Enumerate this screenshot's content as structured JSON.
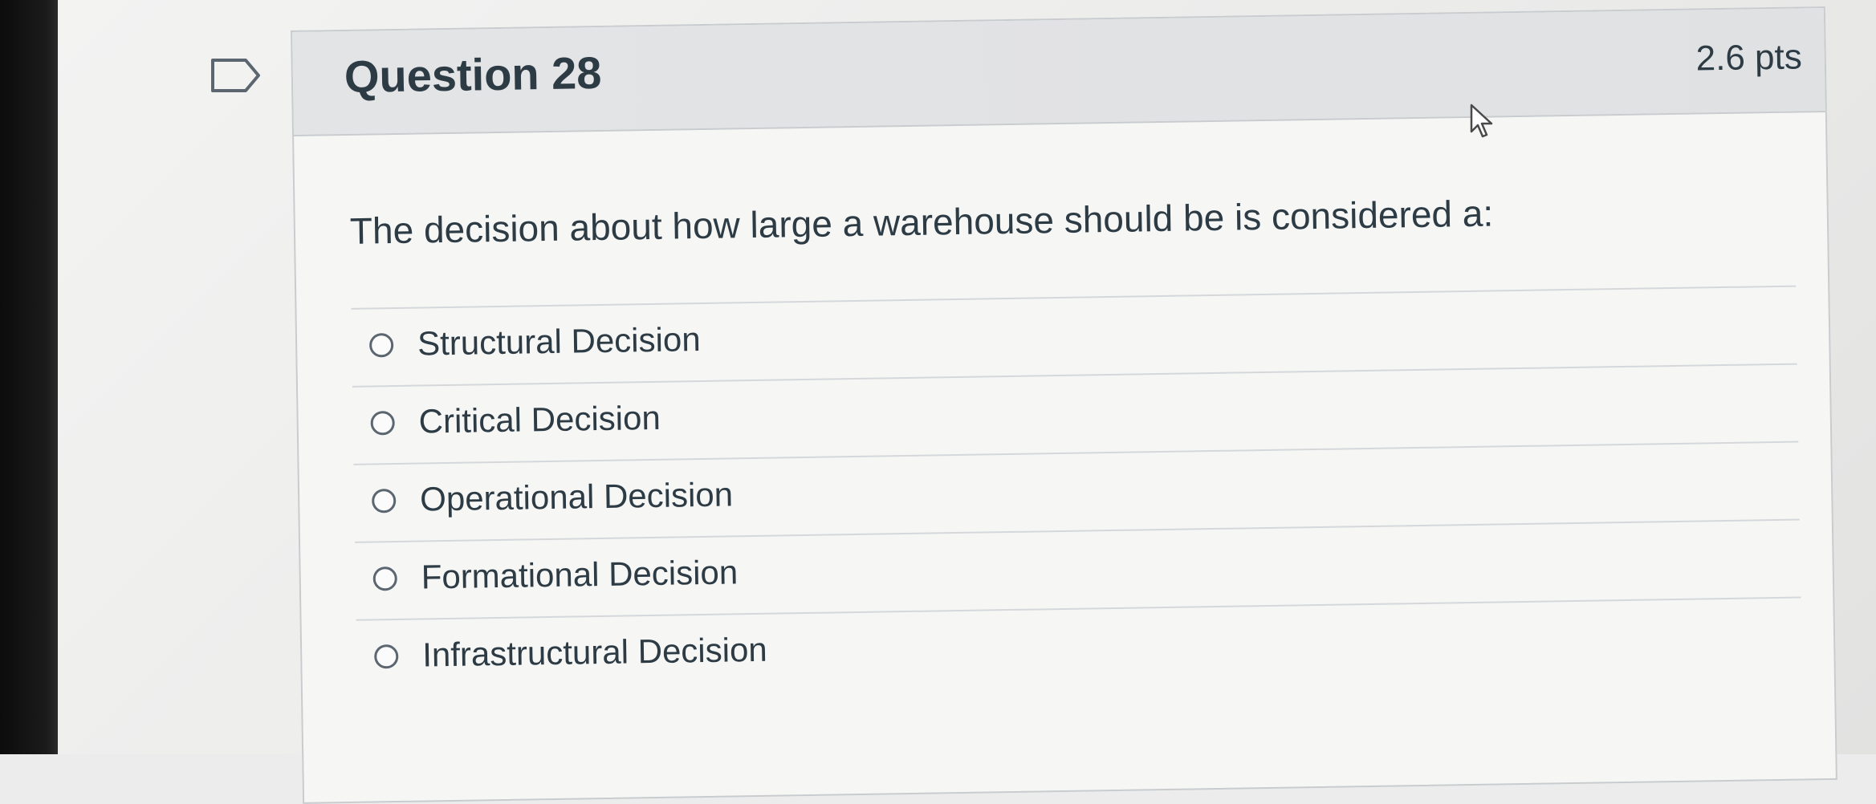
{
  "question": {
    "title": "Question 28",
    "points": "2.6 pts",
    "text": "The decision about how large a warehouse should be is considered a:",
    "options": [
      {
        "label": "Structural Decision",
        "selected": false
      },
      {
        "label": "Critical Decision",
        "selected": false
      },
      {
        "label": "Operational Decision",
        "selected": false
      },
      {
        "label": "Formational Decision",
        "selected": false
      },
      {
        "label": "Infrastructural Decision",
        "selected": false
      }
    ]
  },
  "icons": {
    "flag": "bookmark-flag-icon",
    "cursor": "mouse-pointer-icon",
    "radio": "radio-empty-icon"
  },
  "colors": {
    "header_bg": "#e3e4e6",
    "text": "#2d3b45",
    "border": "#c9cccf"
  }
}
